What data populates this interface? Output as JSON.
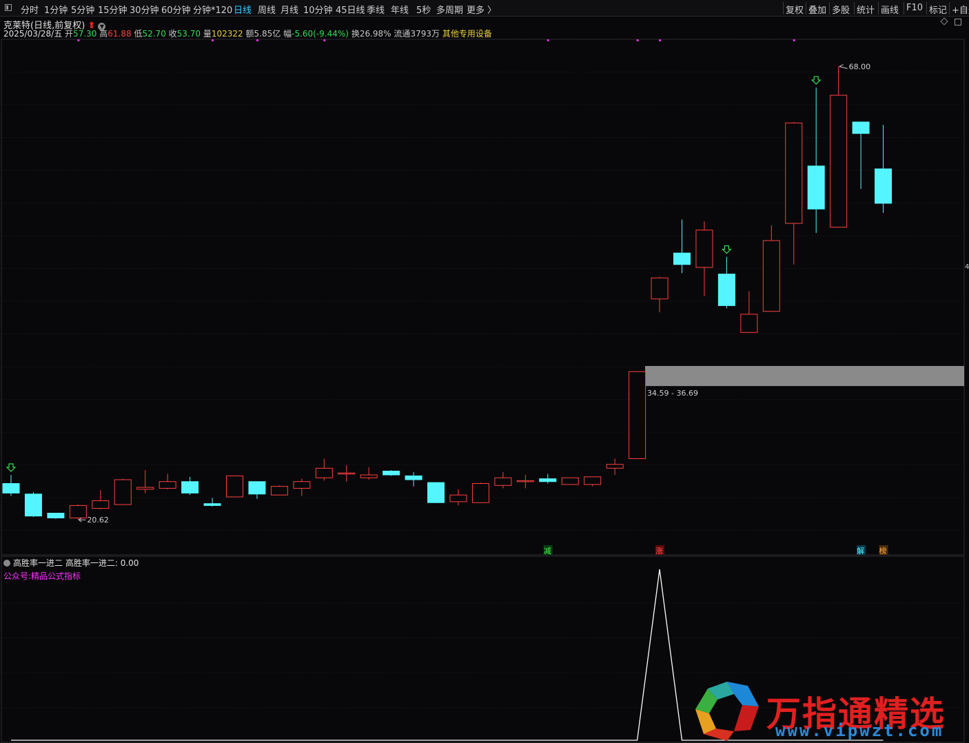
{
  "toolbar": {
    "tabs": [
      "分时",
      "1分钟",
      "5分钟",
      "15分钟",
      "30分钟",
      "60分钟",
      "分钟*120",
      "日线",
      "周线",
      "月线",
      "10分钟",
      "45日线",
      "季线",
      "年线",
      "5秒",
      "多周期",
      "更多 〉"
    ],
    "active_tab": "日线",
    "right_tabs": [
      "复权",
      "叠加",
      "多股",
      "统计",
      "画线",
      "F10",
      "标记",
      "+自选"
    ]
  },
  "stock": {
    "name": "克莱特",
    "period_label": "(日线,前复权)",
    "date": "2025/03/28/五",
    "open_label": "开",
    "open": "57.30",
    "high_label": "高",
    "high": "61.88",
    "low_label": "低",
    "low": "52.70",
    "close_label": "收",
    "close": "53.70",
    "volume_label": "量",
    "volume": "102322",
    "amount_label": "额",
    "amount": "5.85亿",
    "change_label": "幅",
    "change": "-5.60(-9.44%)",
    "turnover_label": "换",
    "turnover": "26.98%",
    "float_label": "流通",
    "float_shares": "3793万",
    "sector": "其他专用设备"
  },
  "annotations": {
    "max_price": "68.00",
    "min_price": "20.62",
    "gap_zone": "34.59 - 36.69",
    "markers": [
      "减",
      "涨",
      "解",
      "榜"
    ],
    "right_edge": "4"
  },
  "indicator": {
    "name": "高胜率一进二",
    "value_label": "高胜率一进二: 0.00",
    "subtitle": "公众号:精品公式指标"
  },
  "watermark": {
    "text": "万指通精选",
    "url": "www.vipwzt.com"
  },
  "colors": {
    "up": "#ff4040",
    "down": "#55f5ff",
    "background": "#08080a",
    "indicator_line": "#ffffff",
    "gap_zone": "#8a8a8a"
  },
  "chart_data": [
    {
      "type": "candlestick",
      "title": "克莱特 (日线,前复权)",
      "ylim": [
        18.6,
        70.2
      ],
      "gap_zone": [
        34.59,
        36.69
      ],
      "candles": [
        {
          "o": 24.4,
          "h": 25.3,
          "l": 23.1,
          "c": 23.4
        },
        {
          "o": 23.3,
          "h": 23.5,
          "l": 20.9,
          "c": 21.0
        },
        {
          "o": 21.3,
          "h": 21.3,
          "l": 20.7,
          "c": 20.8
        },
        {
          "o": 20.8,
          "h": 22.2,
          "l": 20.6,
          "c": 22.1
        },
        {
          "o": 21.8,
          "h": 23.7,
          "l": 21.7,
          "c": 22.6
        },
        {
          "o": 22.2,
          "h": 24.9,
          "l": 22.2,
          "c": 24.8
        },
        {
          "o": 23.8,
          "h": 25.8,
          "l": 23.4,
          "c": 24.0
        },
        {
          "o": 23.9,
          "h": 25.4,
          "l": 23.8,
          "c": 24.6
        },
        {
          "o": 24.6,
          "h": 25.1,
          "l": 23.2,
          "c": 23.4
        },
        {
          "o": 22.3,
          "h": 22.9,
          "l": 22.0,
          "c": 22.1
        },
        {
          "o": 23.0,
          "h": 25.2,
          "l": 23.0,
          "c": 25.2
        },
        {
          "o": 24.6,
          "h": 24.6,
          "l": 22.8,
          "c": 23.3
        },
        {
          "o": 23.2,
          "h": 24.2,
          "l": 23.2,
          "c": 24.1
        },
        {
          "o": 23.9,
          "h": 24.9,
          "l": 23.1,
          "c": 24.6
        },
        {
          "o": 25.0,
          "h": 27.0,
          "l": 24.7,
          "c": 26.0
        },
        {
          "o": 25.5,
          "h": 26.3,
          "l": 24.6,
          "c": 25.5
        },
        {
          "o": 25.0,
          "h": 26.1,
          "l": 24.8,
          "c": 25.3
        },
        {
          "o": 25.7,
          "h": 25.8,
          "l": 25.2,
          "c": 25.3
        },
        {
          "o": 25.2,
          "h": 25.6,
          "l": 24.1,
          "c": 24.8
        },
        {
          "o": 24.5,
          "h": 24.5,
          "l": 22.4,
          "c": 22.4
        },
        {
          "o": 22.5,
          "h": 23.8,
          "l": 22.1,
          "c": 23.2
        },
        {
          "o": 22.4,
          "h": 24.5,
          "l": 22.4,
          "c": 24.4
        },
        {
          "o": 24.2,
          "h": 25.6,
          "l": 23.9,
          "c": 25.0
        },
        {
          "o": 24.7,
          "h": 25.3,
          "l": 23.9,
          "c": 24.7
        },
        {
          "o": 24.9,
          "h": 25.4,
          "l": 24.4,
          "c": 24.6
        },
        {
          "o": 24.3,
          "h": 25.0,
          "l": 24.3,
          "c": 25.0
        },
        {
          "o": 24.3,
          "h": 25.1,
          "l": 24.1,
          "c": 25.1
        },
        {
          "o": 26.0,
          "h": 27.0,
          "l": 25.3,
          "c": 26.4
        },
        {
          "o": 27.0,
          "h": 36.1,
          "l": 27.0,
          "c": 36.1
        },
        {
          "o": 43.7,
          "h": 46.0,
          "l": 42.3,
          "c": 45.9
        },
        {
          "o": 48.5,
          "h": 52.0,
          "l": 46.4,
          "c": 47.3
        },
        {
          "o": 47.0,
          "h": 51.8,
          "l": 44.0,
          "c": 50.9
        },
        {
          "o": 46.3,
          "h": 48.1,
          "l": 42.7,
          "c": 43.0
        },
        {
          "o": 40.2,
          "h": 44.5,
          "l": 40.2,
          "c": 42.1
        },
        {
          "o": 42.4,
          "h": 51.4,
          "l": 42.4,
          "c": 49.8
        },
        {
          "o": 51.6,
          "h": 62.2,
          "l": 47.3,
          "c": 62.1
        },
        {
          "o": 57.6,
          "h": 65.8,
          "l": 50.6,
          "c": 53.1
        },
        {
          "o": 51.2,
          "h": 68.0,
          "l": 51.2,
          "c": 65.0
        },
        {
          "o": 62.2,
          "h": 62.2,
          "l": 55.2,
          "c": 61.0
        },
        {
          "o": 57.3,
          "h": 61.9,
          "l": 52.7,
          "c": 53.7
        }
      ]
    },
    {
      "type": "line",
      "title": "高胜率一进二",
      "ylim": [
        0,
        1
      ],
      "series": [
        {
          "name": "高胜率一进二",
          "values": [
            0,
            0,
            0,
            0,
            0,
            0,
            0,
            0,
            0,
            0,
            0,
            0,
            0,
            0,
            0,
            0,
            0,
            0,
            0,
            0,
            0,
            0,
            0,
            0,
            0,
            0,
            0,
            0,
            0,
            1,
            0,
            0,
            0,
            0,
            0,
            0,
            0,
            0,
            0,
            0
          ]
        }
      ]
    }
  ]
}
